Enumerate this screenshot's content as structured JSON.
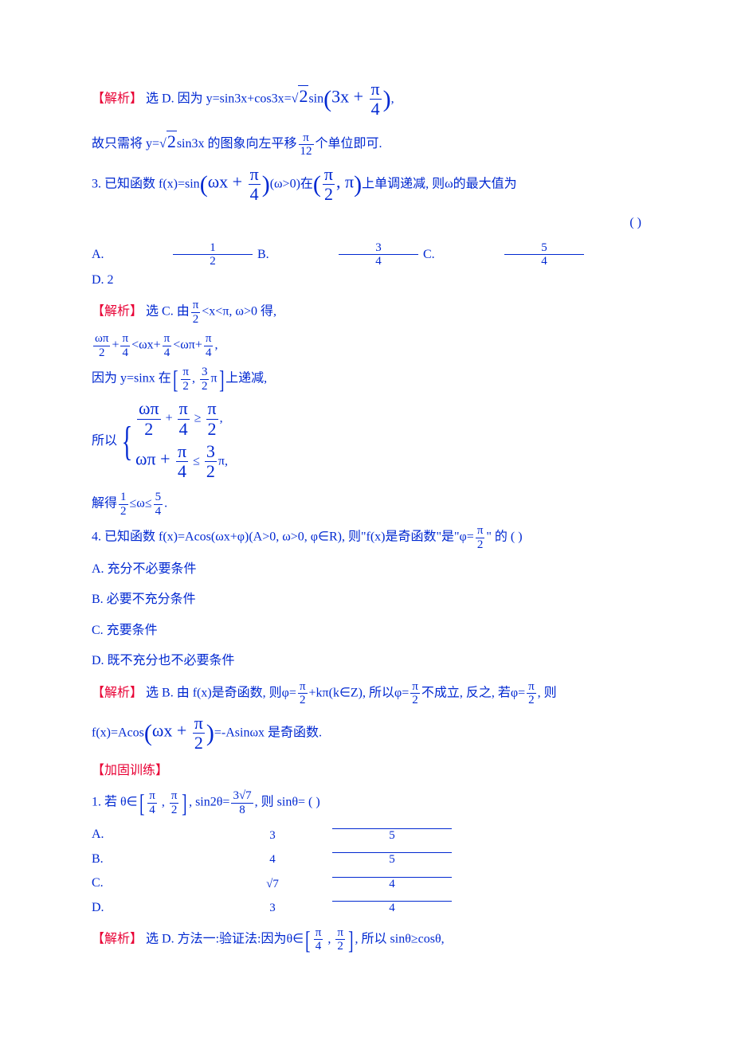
{
  "p2": {
    "analysis_label": "【解析】",
    "text1_a": "选 D. 因为 y=sin3x+cos3x=",
    "sqrt2": "2",
    "text1_b": "sin",
    "inner": "3x + ",
    "frac_pi_4_num": "π",
    "frac_pi_4_den": "4",
    "text2_a": "故只需将 y=",
    "text2_b": "sin3x 的图象向左平移",
    "frac_pi_12_num": "π",
    "frac_pi_12_den": "12",
    "text2_c": "个单位即可."
  },
  "q3": {
    "text_a": "3. 已知函数 f(x)=sin",
    "inner_a": "ωx + ",
    "frac_pi_4_num": "π",
    "frac_pi_4_den": "4",
    "text_b": "(ω>0)在",
    "frac_pi_2_num": "π",
    "frac_pi_2_den": "2",
    "text_c": ", π",
    "text_d": "上单调递减, 则ω的最大值为",
    "paren": "(    )",
    "optA_lbl": "A.",
    "optA_num": "1",
    "optA_den": "2",
    "optB_lbl": "B.",
    "optB_num": "3",
    "optB_den": "4",
    "optC_lbl": "C.",
    "optC_num": "5",
    "optC_den": "4",
    "optD": "D. 2",
    "ans_a": "选 C. 由",
    "ans_a2": "<x<π, ω>0 得,",
    "ineq_l_num": "ωπ",
    "ineq_l_den": "2",
    "plus": "+",
    "lt": "<",
    "mid": "ωx+",
    "rhs": "ωπ+",
    "text_dec_a": "因为 y=sinx 在",
    "dec_lo_num": "π",
    "dec_lo_den": "2",
    "comma": ", ",
    "dec_hi_num": "3",
    "dec_hi_den": "2",
    "dec_pi": "π",
    "text_dec_b": "上递减,",
    "so": "所以",
    "brace1_num1": "ωπ",
    "brace1_den1": "2",
    "brace1_num2": "π",
    "brace1_den2": "4",
    "ge": " ≥ ",
    "brace1_num3": "π",
    "brace1_den3": "2",
    "brace2_a": "ωπ + ",
    "le": " ≤ ",
    "brace2_num": "3",
    "brace2_den": "2",
    "solve_a": "解得",
    "solve_num1": "1",
    "solve_den1": "2",
    "solve_mid": "≤ω≤",
    "solve_num2": "5",
    "solve_den2": "4",
    "period": "."
  },
  "q4": {
    "text_a": "4. 已知函数 f(x)=Acos(ωx+φ)(A>0, ω>0, φ∈R), 则\"f(x)是奇函数\"是\"φ=",
    "frac_num": "π",
    "frac_den": "2",
    "text_b": "\" 的  (    )",
    "optA": "A. 充分不必要条件",
    "optB": "B. 必要不充分条件",
    "optC": "C. 充要条件",
    "optD": "D. 既不充分也不必要条件",
    "ans_a": "选 B. 由 f(x)是奇函数, 则φ=",
    "ans_b": "+kπ(k∈Z), 所以φ=",
    "ans_c": "不成立, 反之, 若φ=",
    "ans_d": ", 则",
    "ans_e": "f(x)=Acos",
    "inner": "ωx + ",
    "ans_f": "=-Asinωx 是奇函数."
  },
  "extra": {
    "title": "【加固训练】",
    "q1_a": "1. 若 θ∈",
    "lo_num": "π",
    "lo_den": "4",
    "comma": " , ",
    "hi_num": "π",
    "hi_den": "2",
    "q1_b": ", sin2θ=",
    "val_num": "3√7",
    "val_den": "8",
    "q1_c": ", 则 sinθ=  (    )",
    "optA_lbl": "A.",
    "optA_num": "3",
    "optA_den": "5",
    "optB_lbl": "B.",
    "optB_num": "4",
    "optB_den": "5",
    "optC_lbl": "C.",
    "optC_num": "√7",
    "optC_den": "4",
    "optD_lbl": "D.",
    "optD_num": "3",
    "optD_den": "4",
    "ans_a": "选 D. 方法一:验证法:因为θ∈",
    "ans_b": ", 所以 sinθ≥cosθ,"
  },
  "analysis_label": "【解析】"
}
